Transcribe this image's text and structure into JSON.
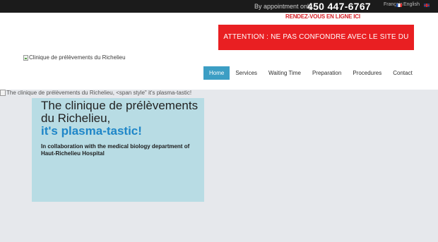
{
  "topbar": {
    "appointment_text": "By appointment only",
    "phone": "450 447-6767",
    "lang_fr": "Français",
    "lang_en": "English"
  },
  "header": {
    "rdv_link": "RENDEZ-VOUS EN LIGNE ICI",
    "attention_banner": "ATTENTION : NE PAS CONFONDRE AVEC LE SITE DU CLSC.",
    "logo_alt": "Clinique de prélèvements du Richelieu"
  },
  "nav": {
    "items": [
      {
        "label": "Home"
      },
      {
        "label": "Services"
      },
      {
        "label": "Waiting Time"
      },
      {
        "label": "Preparation"
      },
      {
        "label": "Procedures"
      },
      {
        "label": "Contact"
      }
    ]
  },
  "hero": {
    "image_alt": "The clinique de prélèvements du Richelieu, <span style\" it's plasma-tastic!",
    "title": "The clinique de prélèvements du Richelieu,",
    "tagline": "it's plasma-tastic!",
    "subtitle": "In collaboration with the medical biology department of Haut-Richelieu Hospital"
  },
  "colors": {
    "accent": "#3c9ec4",
    "alert": "#e91f22",
    "hero_box": "#b8dce4",
    "tagline": "#1e86c8"
  }
}
